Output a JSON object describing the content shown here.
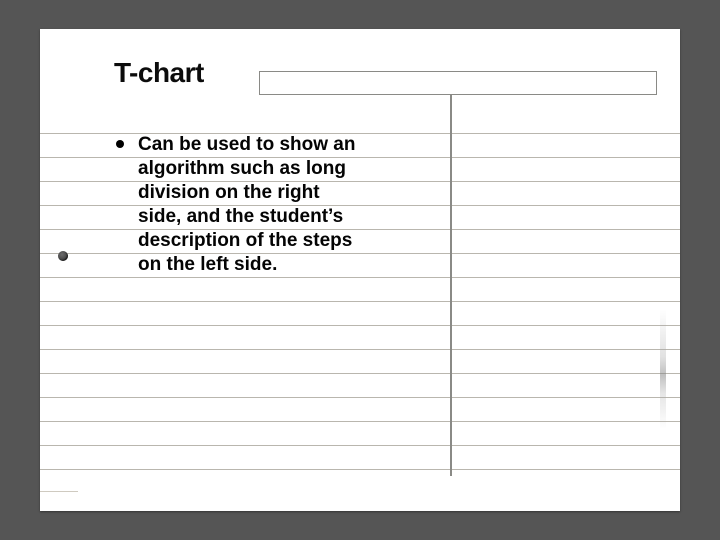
{
  "slide": {
    "title": "T-chart",
    "bullets": [
      "Can be used to show an algorithm such as long division on the right side, and the student’s description of the steps on the left side."
    ]
  }
}
